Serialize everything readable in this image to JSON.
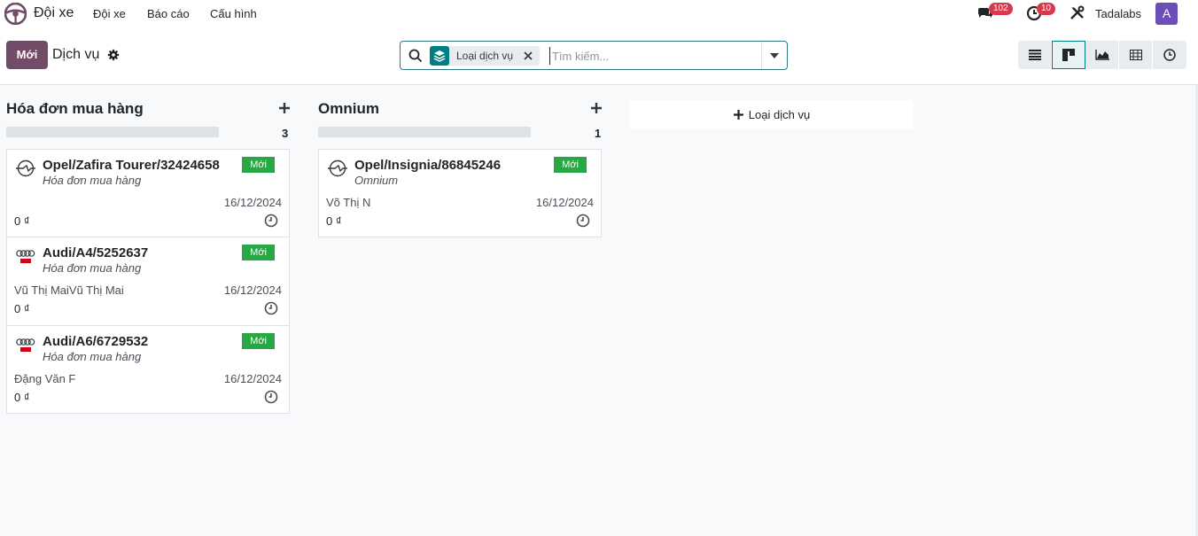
{
  "navbar": {
    "app_name": "Đội xe",
    "menu": [
      "Đội xe",
      "Báo cáo",
      "Cấu hình"
    ],
    "messages_count": "102",
    "activities_count": "10",
    "company": "Tadalabs",
    "avatar_letter": "A"
  },
  "control_panel": {
    "new_label": "Mới",
    "title": "Dịch vụ",
    "facet_label": "Loại dịch vụ",
    "search_placeholder": "Tìm kiếm...",
    "views": [
      "list-view",
      "kanban-view",
      "graph-view",
      "pivot-view",
      "activity-view"
    ],
    "active_view": "kanban-view"
  },
  "columns": [
    {
      "title": "Hóa đơn mua hàng",
      "count": "3",
      "cards": [
        {
          "brand": "opel",
          "title": "Opel/Zafira Tourer/32424658",
          "tag": "Mới",
          "subtitle": "Hóa đơn mua hàng",
          "person": "",
          "date": "16/12/2024",
          "amount": "0 ₫"
        },
        {
          "brand": "audi",
          "title": "Audi/A4/5252637",
          "tag": "Mới",
          "subtitle": "Hóa đơn mua hàng",
          "person": "Vũ Thị MaiVũ Thị Mai",
          "date": "16/12/2024",
          "amount": "0 ₫"
        },
        {
          "brand": "audi",
          "title": "Audi/A6/6729532",
          "tag": "Mới",
          "subtitle": "Hóa đơn mua hàng",
          "person": "Đặng Văn F",
          "date": "16/12/2024",
          "amount": "0 ₫"
        }
      ]
    },
    {
      "title": "Omnium",
      "count": "1",
      "cards": [
        {
          "brand": "opel",
          "title": "Opel/Insignia/86845246",
          "tag": "Mới",
          "subtitle": "Omnium",
          "person": "Võ Thị N",
          "date": "16/12/2024",
          "amount": "0 ₫"
        }
      ]
    }
  ],
  "add_column_label": "Loại dịch vụ",
  "colors": {
    "primary": "#714b67",
    "accent": "#017e84",
    "tag_green": "#28a745",
    "badge_red": "#d63a4a"
  }
}
